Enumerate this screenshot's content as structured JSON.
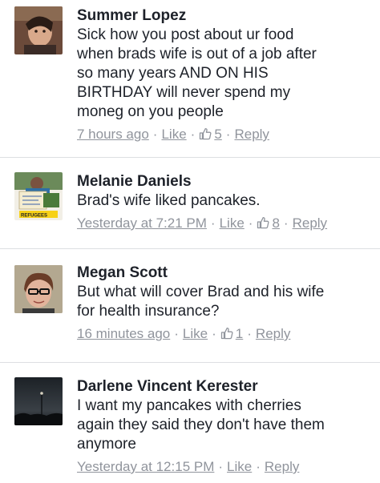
{
  "comments": [
    {
      "name": "Summer Lopez",
      "text": "Sick how you post about ur food\nwhen brads wife is out of a job after\nso many years AND ON HIS\nBIRTHDAY will never spend my\nmoneg on you people",
      "time": "7 hours ago",
      "like": "Like",
      "likes": "5",
      "reply": "Reply"
    },
    {
      "name": "Melanie Daniels",
      "text": "Brad's wife liked pancakes.",
      "time": "Yesterday at 7:21 PM",
      "like": "Like",
      "likes": "8",
      "reply": "Reply",
      "avatar_text": "REFUGEES"
    },
    {
      "name": "Megan Scott",
      "text": "But what will cover Brad and his wife\nfor health insurance?",
      "time": "16 minutes ago",
      "like": "Like",
      "likes": "1",
      "reply": "Reply"
    },
    {
      "name": "Darlene Vincent Kerester",
      "text": "I want my pancakes with cherries\nagain they said they don't have them\nanymore",
      "time": "Yesterday at 12:15 PM",
      "like": "Like",
      "reply": "Reply"
    }
  ],
  "icons": {
    "like": "thumbs-up-icon"
  },
  "colors": {
    "meta": "#90949c",
    "text": "#1d2129",
    "divider": "#dddfe2"
  }
}
